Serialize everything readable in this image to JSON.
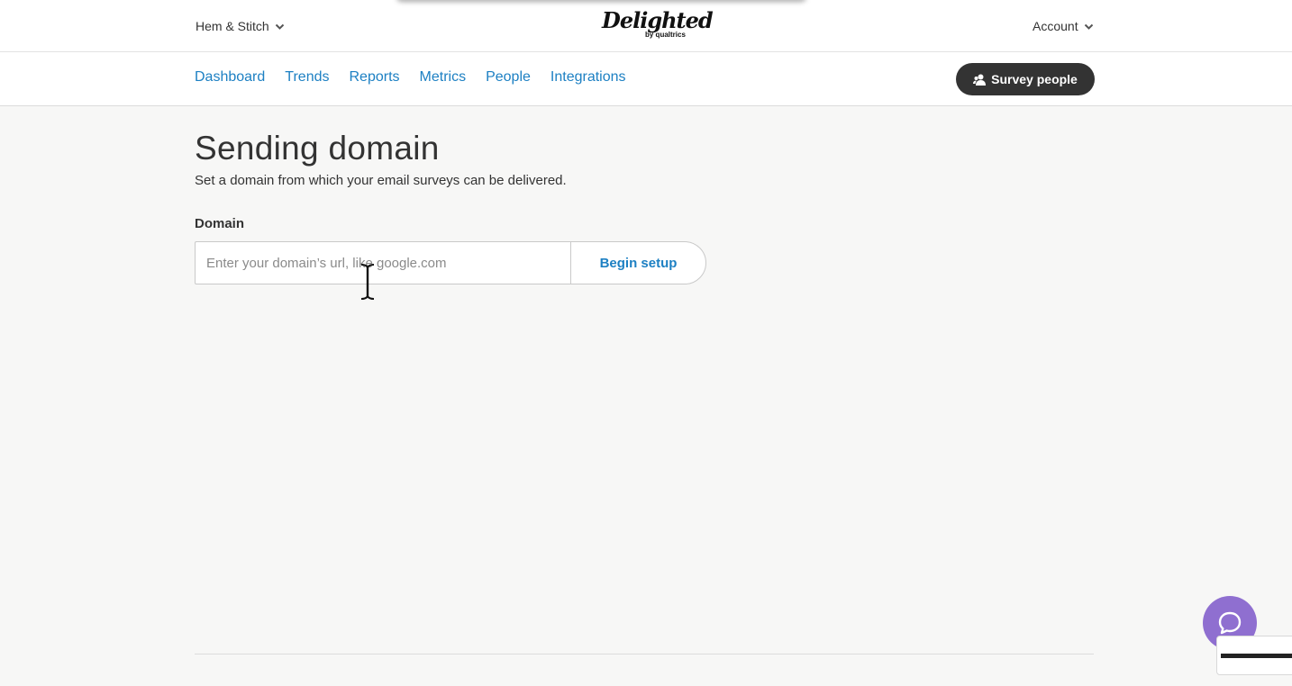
{
  "topbar": {
    "org_name": "Hem & Stitch",
    "logo_text": "Delighted",
    "logo_subtext": "by qualtrics",
    "account_label": "Account"
  },
  "nav": {
    "links": [
      {
        "label": "Dashboard"
      },
      {
        "label": "Trends"
      },
      {
        "label": "Reports"
      },
      {
        "label": "Metrics"
      },
      {
        "label": "People"
      },
      {
        "label": "Integrations"
      }
    ],
    "survey_button_label": "Survey people"
  },
  "main": {
    "title": "Sending domain",
    "subtitle": "Set a domain from which your email surveys can be delivered.",
    "domain_label": "Domain",
    "domain_value": "",
    "domain_placeholder": "Enter your domain’s url, like google.com",
    "begin_button_label": "Begin setup"
  },
  "icons": {
    "org_chevron": "chevron-down-icon",
    "account_chevron": "chevron-down-icon",
    "survey_icon": "people-icon",
    "chat_icon": "chat-bubble-icon",
    "cursor": "text-cursor-icon"
  },
  "colors": {
    "link": "#1d80c3",
    "dark_button": "#333333",
    "chat": "#8f6fd0",
    "background": "#f7f7f6"
  }
}
